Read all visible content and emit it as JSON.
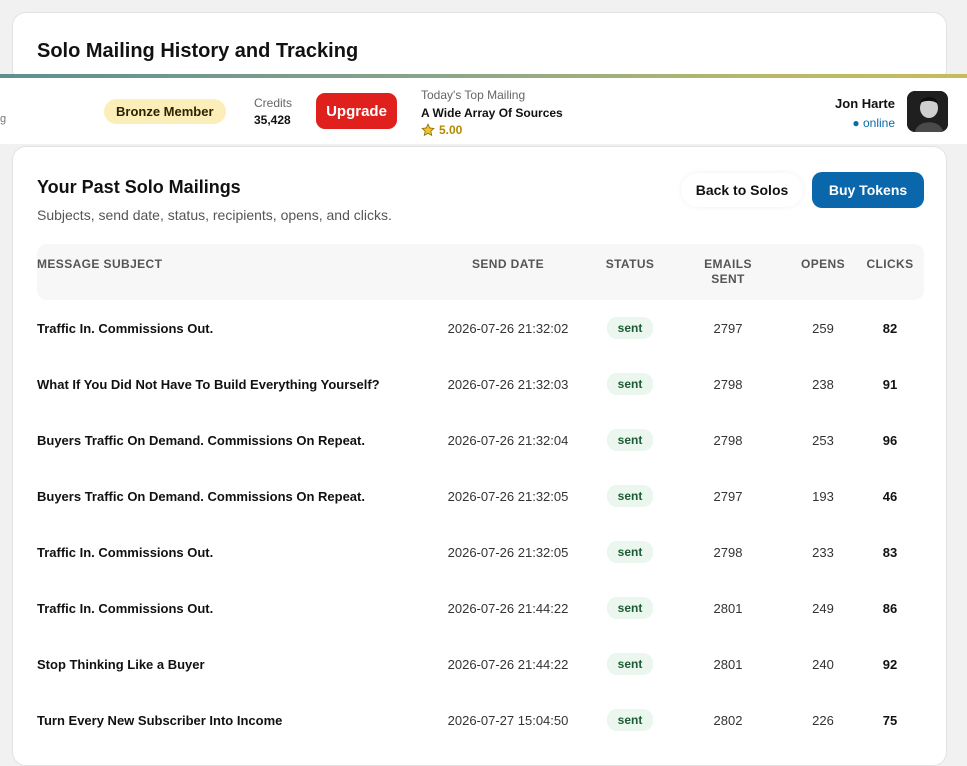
{
  "page": {
    "title": "Solo Mailing History and Tracking"
  },
  "member_bar": {
    "edge_glyph": "g",
    "membership": "Bronze Member",
    "credits_label": "Credits",
    "credits_value": "35,428",
    "upgrade_label": "Upgrade",
    "top_mailing_label": "Today's Top Mailing",
    "top_mailing_name": "A Wide Array Of Sources",
    "top_mailing_rating": "5.00",
    "user_name": "Jon Harte",
    "user_status": "● online"
  },
  "section": {
    "title": "Your Past Solo Mailings",
    "subtitle": "Subjects, send date, status, recipients, opens, and clicks.",
    "back_label": "Back to Solos",
    "buy_label": "Buy Tokens"
  },
  "table": {
    "headers": [
      "MESSAGE SUBJECT",
      "SEND DATE",
      "STATUS",
      "EMAILS SENT",
      "OPENS",
      "CLICKS"
    ],
    "rows": [
      {
        "subject": "Traffic In. Commissions Out.",
        "date": "2026-07-26 21:32:02",
        "status": "sent",
        "sent": "2797",
        "opens": "259",
        "clicks": "82"
      },
      {
        "subject": "What If You Did Not Have To Build Everything Yourself?",
        "date": "2026-07-26 21:32:03",
        "status": "sent",
        "sent": "2798",
        "opens": "238",
        "clicks": "91"
      },
      {
        "subject": "Buyers Traffic On Demand. Commissions On Repeat.",
        "date": "2026-07-26 21:32:04",
        "status": "sent",
        "sent": "2798",
        "opens": "253",
        "clicks": "96"
      },
      {
        "subject": "Buyers Traffic On Demand. Commissions On Repeat.",
        "date": "2026-07-26 21:32:05",
        "status": "sent",
        "sent": "2797",
        "opens": "193",
        "clicks": "46"
      },
      {
        "subject": "Traffic In. Commissions Out.",
        "date": "2026-07-26 21:32:05",
        "status": "sent",
        "sent": "2798",
        "opens": "233",
        "clicks": "83"
      },
      {
        "subject": "Traffic In. Commissions Out.",
        "date": "2026-07-26 21:44:22",
        "status": "sent",
        "sent": "2801",
        "opens": "249",
        "clicks": "86"
      },
      {
        "subject": "Stop Thinking Like a Buyer",
        "date": "2026-07-26 21:44:22",
        "status": "sent",
        "sent": "2801",
        "opens": "240",
        "clicks": "92"
      },
      {
        "subject": "Turn Every New Subscriber Into Income",
        "date": "2026-07-27 15:04:50",
        "status": "sent",
        "sent": "2802",
        "opens": "226",
        "clicks": "75"
      }
    ]
  },
  "colors": {
    "upgrade": "#e0201c",
    "buy": "#0b67ac",
    "bronze_badge": "#fbeeb8",
    "online": "#0b6aa8",
    "status_pill": "#eaf6ee",
    "rating": "#b38a00"
  },
  "icons": {
    "rating": "star-icon",
    "avatar": "user-avatar-photo"
  }
}
